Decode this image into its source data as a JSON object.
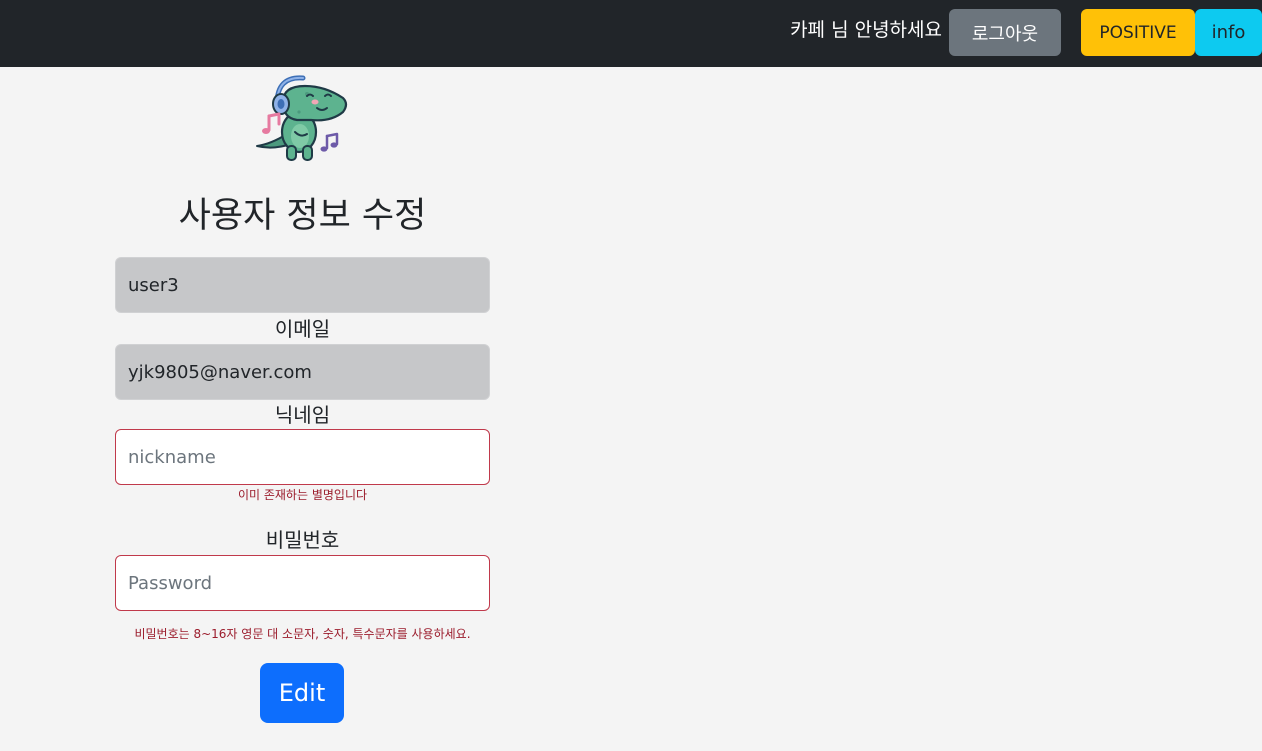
{
  "navbar": {
    "greeting": "카페 님 안녕하세요",
    "logout_label": "로그아웃",
    "positive_label": "POSITIVE",
    "info_label": "info"
  },
  "page": {
    "title": "사용자 정보 수정"
  },
  "form": {
    "username_value": "user3",
    "email_label": "이메일",
    "email_value": "yjk9805@naver.com",
    "nickname_label": "닉네임",
    "nickname_placeholder": "nickname",
    "nickname_error": "이미 존재하는 별명입니다",
    "password_label": "비밀번호",
    "password_placeholder": "Password",
    "password_error": "비밀번호는 8~16자 영문 대 소문자, 숫자, 특수문자를 사용하세요.",
    "edit_label": "Edit"
  },
  "icons": {
    "logo": "dinosaur-with-headphones-icon"
  },
  "colors": {
    "navbar_bg": "#212529",
    "logout_btn": "#6c757d",
    "positive_btn": "#ffc107",
    "info_btn": "#0dcaf0",
    "edit_btn": "#0d6efd",
    "error_text": "#9b1c2c",
    "invalid_border": "#c0394b",
    "readonly_bg": "#c6c7c9"
  }
}
